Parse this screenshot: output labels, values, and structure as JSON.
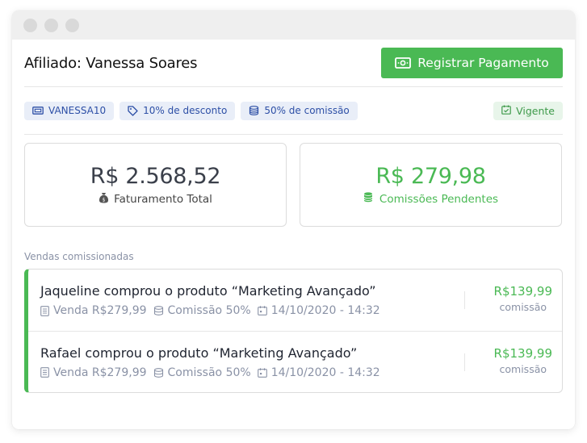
{
  "header": {
    "title": "Afiliado: Vanessa Soares",
    "register_button": "Registrar Pagamento"
  },
  "tags": [
    {
      "icon": "ticket-icon",
      "label": "VANESSA10"
    },
    {
      "icon": "tag-icon",
      "label": "10% de desconto"
    },
    {
      "icon": "coins-icon",
      "label": "50% de comissão"
    }
  ],
  "status": {
    "icon": "calendar-check-icon",
    "label": "Vigente"
  },
  "stats": {
    "revenue": {
      "value": "R$ 2.568,52",
      "label": "Faturamento Total",
      "icon": "money-bag-icon"
    },
    "commissions": {
      "value": "R$ 279,98",
      "label": "Comissões Pendentes",
      "icon": "coins-icon"
    }
  },
  "sales_section_label": "Vendas comissionadas",
  "sales": [
    {
      "title": "Jaqueline comprou o produto “Marketing Avançado”",
      "sale": "Venda R$279,99",
      "commission": "Comissão 50%",
      "date": "14/10/2020 - 14:32",
      "amount": "R$139,99",
      "caption": "comissão"
    },
    {
      "title": "Rafael comprou o produto “Marketing Avançado”",
      "sale": "Venda R$279,99",
      "commission": "Comissão 50%",
      "date": "14/10/2020 - 14:32",
      "amount": "R$139,99",
      "caption": "comissão"
    }
  ],
  "colors": {
    "accent_green": "#4ab954",
    "tag_blue": "#2d4fa6",
    "muted": "#8a92a6"
  }
}
